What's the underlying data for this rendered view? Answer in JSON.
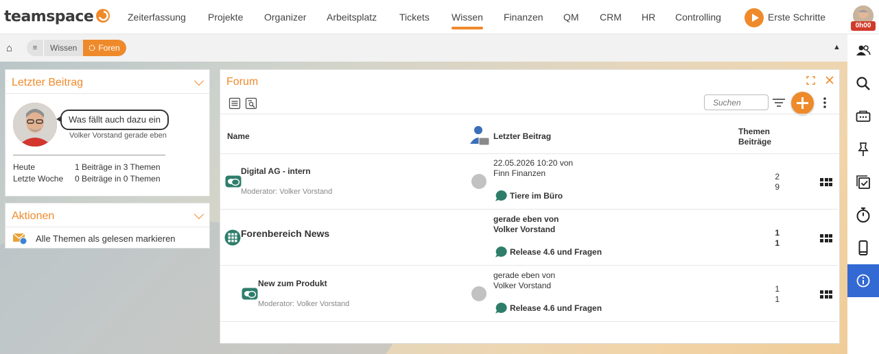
{
  "brand": {
    "name": "teamspace",
    "accent": "#ef8a2b"
  },
  "nav": {
    "items": [
      "Zeiterfassung",
      "Projekte",
      "Organizer",
      "Arbeitsplatz",
      "Tickets",
      "Wissen",
      "Finanzen",
      "QM",
      "CRM",
      "HR",
      "Controlling"
    ],
    "active": "Wissen",
    "first_steps": "Erste Schritte"
  },
  "user": {
    "timer": "0h00"
  },
  "breadcrumb": {
    "items": [
      "Wissen"
    ],
    "active": "Foren"
  },
  "last_post": {
    "title": "Letzter Beitrag",
    "message": "Was fällt auch dazu ein",
    "byline": "Volker Vorstand gerade eben",
    "stats": [
      {
        "label": "Heute",
        "value": "1 Beiträge in 3 Themen"
      },
      {
        "label": "Letzte Woche",
        "value": "0 Beiträge in 0 Themen"
      }
    ]
  },
  "actions": {
    "title": "Aktionen",
    "items": [
      {
        "label": "Alle Themen als gelesen markieren",
        "icon": "envelope-read-icon"
      }
    ]
  },
  "forum": {
    "title": "Forum",
    "search_placeholder": "Suchen",
    "headers": {
      "name": "Name",
      "last_post": "Letzter Beitrag",
      "topics": "Themen",
      "posts": "Beiträge"
    },
    "rows": [
      {
        "name": "Digital AG - intern",
        "moderator": "Moderator: Volker Vorstand",
        "last_line1": "22.05.2026 10:20 von",
        "last_line2": "Finn Finanzen",
        "topic": "Tiere im Büro",
        "topics": "2",
        "posts": "9",
        "unread": false,
        "icon": "forum-bubbles-icon"
      },
      {
        "name": "Forenbereich News",
        "moderator": "",
        "last_line1": "gerade eben von",
        "last_line2": "Volker Vorstand",
        "topic": "Release 4.6 und Fragen",
        "topics": "1",
        "posts": "1",
        "unread": true,
        "icon": "forum-category-icon"
      },
      {
        "name": "New zum Produkt",
        "moderator": "Moderator: Volker Vorstand",
        "last_line1": "gerade eben von",
        "last_line2": "Volker Vorstand",
        "topic": "Release 4.6 und Fragen",
        "topics": "1",
        "posts": "1",
        "unread": false,
        "icon": "forum-bubbles-icon"
      }
    ]
  },
  "sidebar": {
    "icons": [
      "contacts-icon",
      "search-icon",
      "inbox-icon",
      "pin-icon",
      "tasks-icon",
      "stopwatch-icon",
      "mobile-icon",
      "info-icon"
    ],
    "active": "info-icon"
  }
}
